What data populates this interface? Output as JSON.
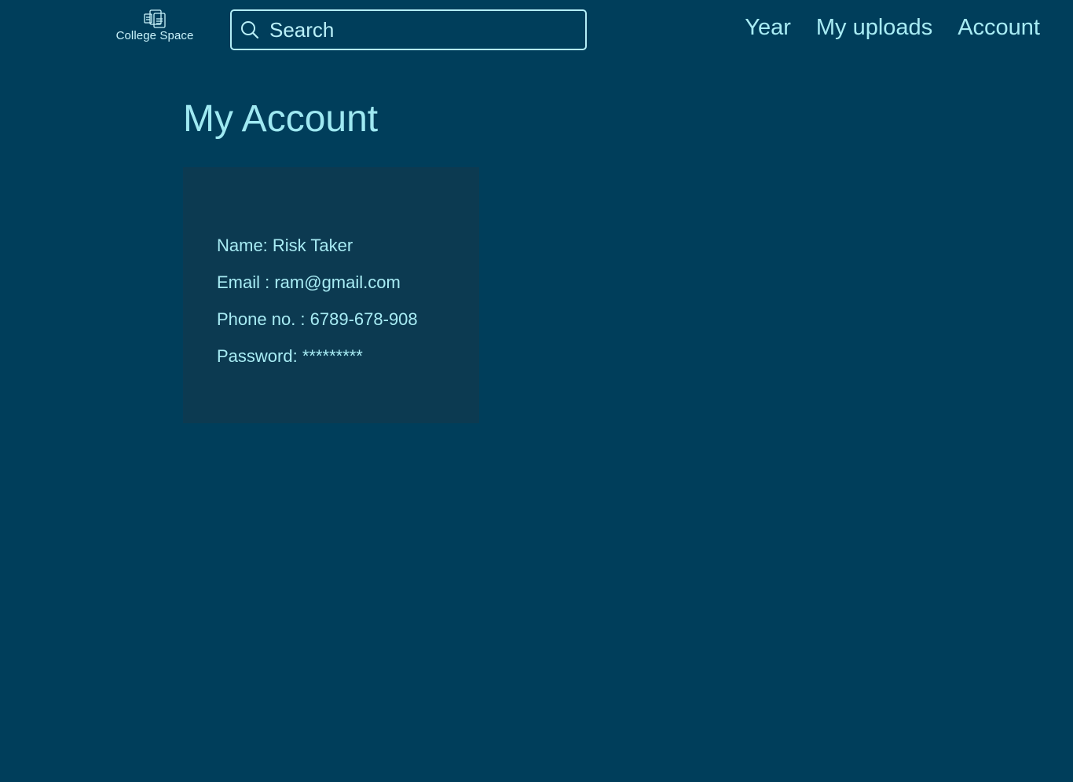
{
  "brand": {
    "name": "College Space",
    "logo_icon": "documents-icon"
  },
  "search": {
    "placeholder": "Search",
    "value": "",
    "icon": "search-icon"
  },
  "nav": {
    "items": [
      {
        "label": "Year"
      },
      {
        "label": "My uploads"
      },
      {
        "label": "Account"
      }
    ]
  },
  "main": {
    "title": "My Account",
    "account": {
      "name_line": "Name: Risk Taker",
      "email_line": "Email : ram@gmail.com",
      "phone_line": "Phone no. : 6789-678-908",
      "password_line": "Password: *********"
    }
  },
  "colors": {
    "background": "#003e5b",
    "card": "#0c3a51",
    "text": "#a8ecf4",
    "border": "#b3eef7"
  }
}
